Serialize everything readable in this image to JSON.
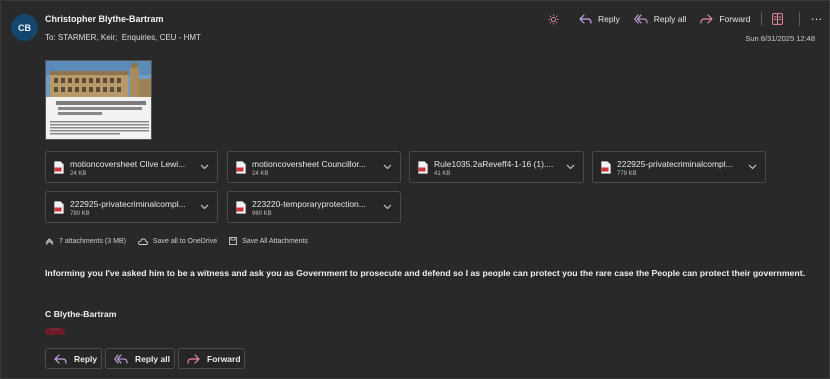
{
  "sender": {
    "initials": "CB",
    "name": "Christopher Blythe-Bartram"
  },
  "recipients": {
    "label": "To:",
    "value": "STARMER, Keir;  Enquiries, CEU - HMT"
  },
  "date": "Sun 8/31/2025 12:48",
  "toolbar": {
    "reply": "Reply",
    "reply_all": "Reply all",
    "forward": "Forward",
    "more": "···"
  },
  "attachments": [
    {
      "name": "motioncoversheet Clive Lewi...",
      "size": "24 KB"
    },
    {
      "name": "motioncoversheet Councillor...",
      "size": "24 KB"
    },
    {
      "name": "Rule1035.2aReveff4-1-16 (1)....",
      "size": "41 KB"
    },
    {
      "name": "222925-privatecriminalcompl...",
      "size": "779 KB"
    },
    {
      "name": "222925-privatecriminalcompl...",
      "size": "780 KB"
    },
    {
      "name": "223220-temporaryprotection...",
      "size": "960 KB"
    }
  ],
  "attachment_meta": {
    "count": "7 attachments (3 MB)",
    "save_onedrive": "Save all to OneDrive",
    "save_all": "Save All Attachments"
  },
  "message": {
    "body": "Informing you I've asked him to be a witness and ask you as Government to  prosecute and defend so I as people can protect you the rare case the People can protect their government.",
    "signature": "C Blythe-Bartram",
    "more_dots": "···"
  },
  "footer": {
    "reply": "Reply",
    "reply_all": "Reply all",
    "forward": "Forward"
  },
  "colors": {
    "background": "#292929",
    "accent_reply": "#c9a6e8",
    "accent_forward": "#e58aa0",
    "avatar": "#15476e",
    "pdf_red": "#d13438"
  }
}
